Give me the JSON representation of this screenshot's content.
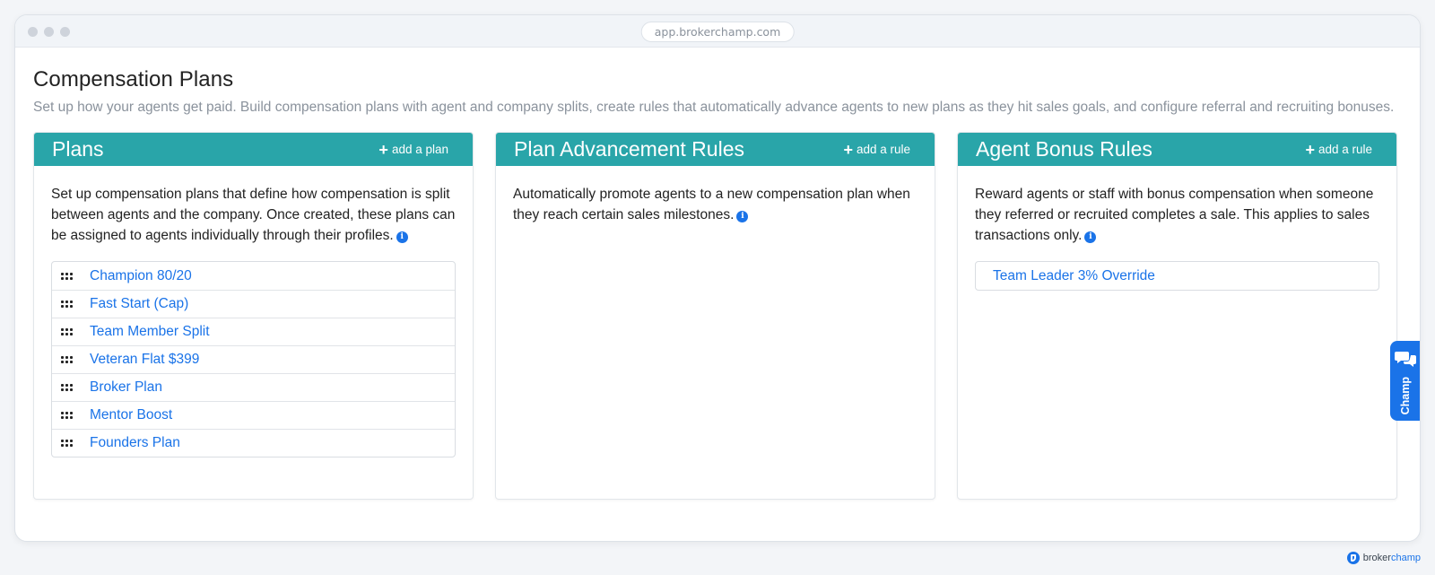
{
  "browser": {
    "url": "app.brokerchamp.com"
  },
  "page": {
    "title": "Compensation Plans",
    "description": "Set up how your agents get paid. Build compensation plans with agent and company splits, create rules that automatically advance agents to new plans as they hit sales goals, and configure referral and recruiting bonuses."
  },
  "cards": {
    "plans": {
      "title": "Plans",
      "action": "add a plan",
      "text": "Set up compensation plans that define how compensation is split between agents and the company. Once created, these plans can be assigned to agents individually through their profiles.",
      "items": [
        "Champion 80/20",
        "Fast Start (Cap)",
        "Team Member Split",
        "Veteran Flat $399",
        "Broker Plan",
        "Mentor Boost",
        "Founders Plan"
      ]
    },
    "advancement": {
      "title": "Plan Advancement Rules",
      "action": "add a rule",
      "text": "Automatically promote agents to a new compensation plan when they reach certain sales milestones."
    },
    "bonus": {
      "title": "Agent Bonus Rules",
      "action": "add a rule",
      "text": "Reward agents or staff with bonus compensation when someone they referred or recruited completes a sale. This applies to sales transactions only.",
      "items": [
        "Team Leader 3% Override"
      ]
    }
  },
  "chat": {
    "label": "Champ",
    "icon": "chat-bubbles-icon"
  },
  "footer": {
    "brand_prefix": "broker",
    "brand_suffix": "champ"
  },
  "colors": {
    "header": "#29a5a9",
    "link": "#1a73e8",
    "accent": "#1a73e8"
  },
  "icons": {
    "add": "plus-icon",
    "info": "info-icon",
    "drag": "drag-handle-icon"
  }
}
